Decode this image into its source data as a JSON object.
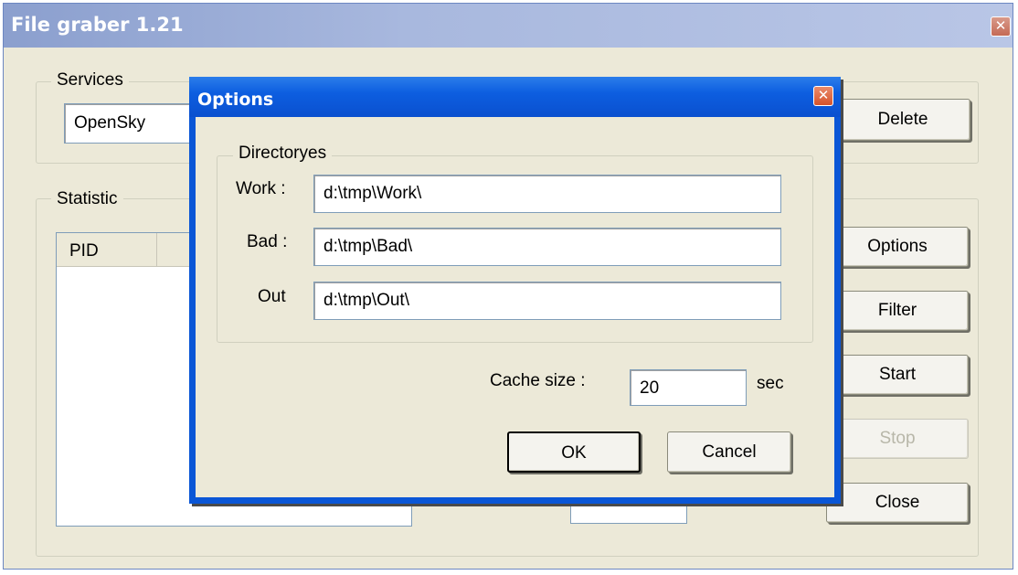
{
  "main_window": {
    "title": "File graber 1.21",
    "services": {
      "legend": "Services",
      "selected_value": "OpenSky",
      "delete_label": "Delete"
    },
    "statistic": {
      "legend": "Statistic",
      "column_pid": "PID"
    },
    "buttons": {
      "options": "Options",
      "filter": "Filter",
      "start": "Start",
      "stop": "Stop",
      "close": "Close"
    }
  },
  "options_dialog": {
    "title": "Options",
    "directories": {
      "legend": "Directoryes",
      "work_label": "Work :",
      "work_value": "d:\\tmp\\Work\\",
      "bad_label": "Bad :",
      "bad_value": "d:\\tmp\\Bad\\",
      "out_label": "Out",
      "out_value": "d:\\tmp\\Out\\"
    },
    "cache": {
      "label": "Cache size :",
      "value": "20",
      "unit": "sec"
    },
    "ok_label": "OK",
    "cancel_label": "Cancel"
  },
  "icons": {
    "close": "close-icon"
  },
  "colors": {
    "dialog_title_blue": "#0a56d6",
    "inactive_title": "#a8b8de",
    "xp_face": "#ece9d8",
    "close_red": "#d6532b"
  }
}
